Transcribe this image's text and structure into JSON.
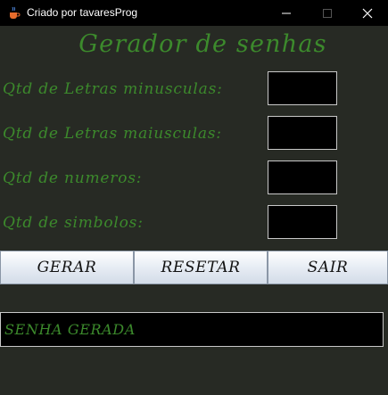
{
  "window": {
    "title": "Criado por tavaresProg"
  },
  "heading": "Gerador de senhas",
  "fields": [
    {
      "label": "Qtd de Letras minusculas:",
      "value": ""
    },
    {
      "label": "Qtd de Letras maiusculas:",
      "value": ""
    },
    {
      "label": "Qtd de numeros:",
      "value": ""
    },
    {
      "label": "Qtd de simbolos:",
      "value": ""
    }
  ],
  "buttons": {
    "gerar": "GERAR",
    "resetar": "RESETAR",
    "sair": "SAIR"
  },
  "output": {
    "text": "SENHA GERADA"
  },
  "colors": {
    "background": "#272a24",
    "accent_text": "#3c8a2c",
    "titlebar": "#000000"
  },
  "icons": [
    "java-cup-icon",
    "minimize-icon",
    "maximize-icon",
    "close-icon"
  ]
}
